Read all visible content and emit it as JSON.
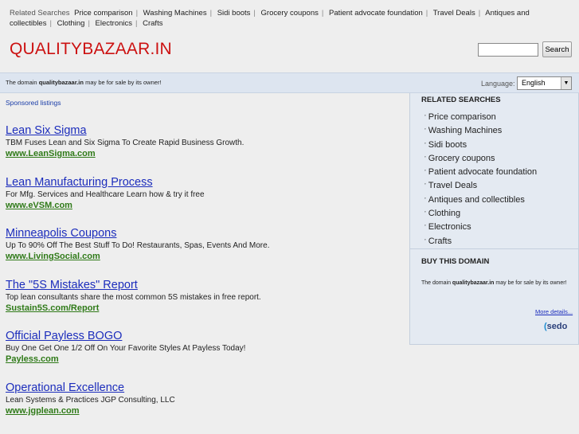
{
  "topbar": {
    "label": "Related Searches",
    "links": [
      "Price comparison",
      "Washing Machines",
      "Sidi boots",
      "Grocery coupons",
      "Patient advocate foundation",
      "Travel Deals",
      "Antiques and collectibles",
      "Clothing",
      "Electronics",
      "Crafts"
    ]
  },
  "header": {
    "logo": "QUALITYBAZAAR.IN",
    "search_placeholder": "",
    "search_button": "Search"
  },
  "notice": {
    "prefix": "The domain ",
    "domain": "qualitybazaar.in",
    "suffix": " may be for sale by its owner!",
    "language_label": "Language:",
    "language_value": "English",
    "language_arrow": "▼"
  },
  "main": {
    "sponsored_label": "Sponsored listings",
    "ads": [
      {
        "title": "Lean Six Sigma",
        "desc": "TBM Fuses Lean and Six Sigma To Create Rapid Business Growth.",
        "url": "www.LeanSigma.com"
      },
      {
        "title": "Lean Manufacturing Process",
        "desc": "For Mfg. Services and Healthcare Learn how & try it free",
        "url": "www.eVSM.com"
      },
      {
        "title": "Minneapolis Coupons",
        "desc": "Up To 90% Off The Best Stuff To Do! Restaurants, Spas, Events And More.",
        "url": "www.LivingSocial.com"
      },
      {
        "title": "The \"5S Mistakes\" Report",
        "desc": "Top lean consultants share the most common 5S mistakes in free report.",
        "url": "Sustain5S.com/Report"
      },
      {
        "title": "Official Payless BOGO",
        "desc": "Buy One Get One 1/2 Off On Your Favorite Styles At Payless Today!",
        "url": "Payless.com"
      },
      {
        "title": "Operational Excellence",
        "desc": "Lean Systems & Practices JGP Consulting, LLC",
        "url": "www.jgplean.com"
      }
    ]
  },
  "sidebar": {
    "related_heading": "RELATED SEARCHES",
    "bullet": "’",
    "items": [
      "Price comparison",
      "Washing Machines",
      "Sidi boots",
      "Grocery coupons",
      "Patient advocate foundation",
      "Travel Deals",
      "Antiques and collectibles",
      "Clothing",
      "Electronics",
      "Crafts"
    ],
    "buy_heading": "BUY THIS DOMAIN",
    "buy_prefix": "The domain ",
    "buy_domain": "qualitybazaar.in",
    "buy_suffix": " may be for sale by its owner!",
    "more_details": "More details...",
    "sedo_logo": "sedo"
  }
}
